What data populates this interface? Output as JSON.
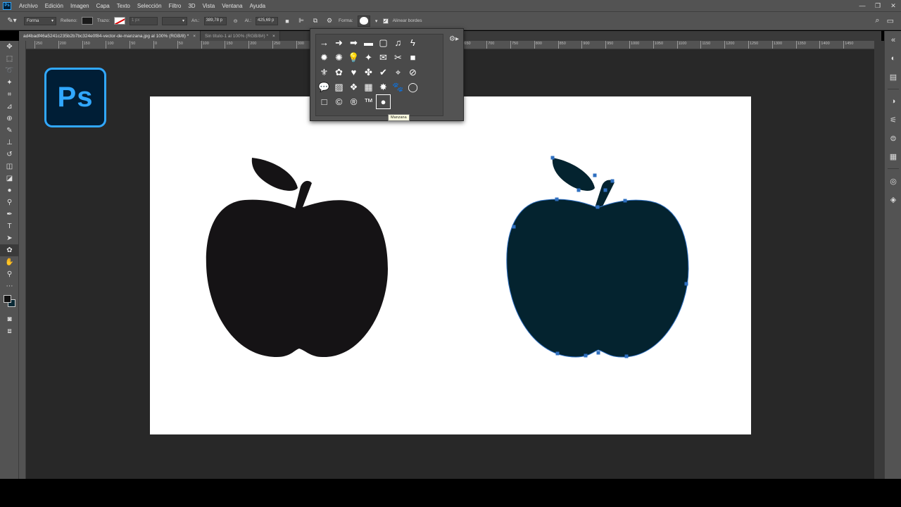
{
  "menubar": {
    "app_icon": "Ps",
    "items": [
      "Archivo",
      "Edición",
      "Imagen",
      "Capa",
      "Texto",
      "Selección",
      "Filtro",
      "3D",
      "Vista",
      "Ventana",
      "Ayuda"
    ],
    "window_controls": [
      "minimize-icon",
      "restore-icon",
      "close-icon"
    ]
  },
  "options_bar": {
    "mode": "Forma",
    "fill_label": "Relleno:",
    "stroke_label": "Trazo:",
    "stroke_width": "1 px",
    "width_label": "An.:",
    "width_value": "389,78 p",
    "height_label": "Al.:",
    "height_value": "425,69 p",
    "shape_label": "Forma:",
    "align_edges_label": "Alinear bordes",
    "align_edges_checked": true
  },
  "tabs": [
    {
      "label": "ad4badf46a5241c235b2b7bc324e0f84-vector-de-manzana.jpg al 100% (RGB/8) *",
      "active": true
    },
    {
      "label": "Sin título-1 al 100% (RGB/8#) *",
      "active": false
    }
  ],
  "ruler": {
    "labels": [
      "250",
      "200",
      "150",
      "100",
      "50",
      "0",
      "50",
      "100",
      "150",
      "200",
      "250",
      "300",
      "350",
      "400",
      "450",
      "500",
      "550",
      "600",
      "650",
      "700",
      "750",
      "800",
      "850",
      "900",
      "950",
      "1000",
      "1050",
      "1100",
      "1150",
      "1200",
      "1250",
      "1300",
      "1350",
      "1400",
      "1450"
    ]
  },
  "logo": {
    "text": "Ps"
  },
  "shape_picker": {
    "shapes": [
      "→",
      "➜",
      "➡",
      "▬",
      "▢",
      "♫",
      "ϟ",
      "✹",
      "✺",
      "💡",
      "✦",
      "✉",
      "✂",
      "■",
      "⚜",
      "✿",
      "♥",
      "✤",
      "✔",
      "⌖",
      "⊘",
      "💬",
      "▨",
      "❖",
      "▦",
      "✸",
      "🐾",
      "◯",
      "□",
      "©",
      "®",
      "™",
      "●"
    ],
    "selected_index": 32,
    "tooltip": "Manzana"
  },
  "colors": {
    "accent": "#31a8ff",
    "apple_left": "#151315",
    "apple_right": "#04232f",
    "path": "#2e6fc0"
  }
}
